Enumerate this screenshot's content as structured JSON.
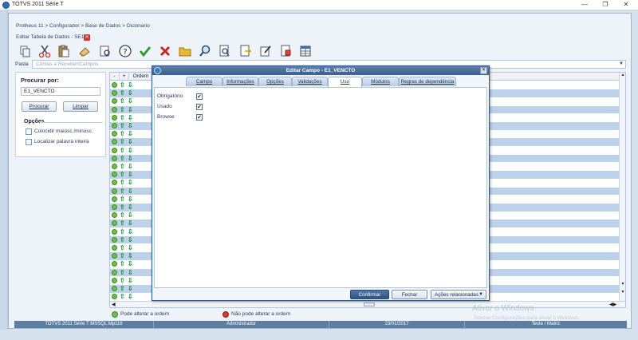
{
  "window": {
    "title": "TOTVS 2011 Série T",
    "minimize": "—",
    "restore": "❐",
    "close": "✕"
  },
  "breadcrumb": "Protheus 11 > Configurador > Base de Dados > Dicionario",
  "doc_tab": {
    "label": "Editar Tabela de Dados - SE1",
    "close": "✕"
  },
  "toolbar": {
    "icons": [
      "copy-icon",
      "cut-icon",
      "paste-icon",
      "eraser-icon",
      "print-preview-icon",
      "help-icon",
      "confirm-check-icon",
      "cancel-x-icon",
      "folder-icon",
      "search-icon",
      "zoom-doc-icon",
      "export-icon",
      "edit-icon",
      "import-icon",
      "table-icon"
    ],
    "colors": {
      "check": "#2e9a2e",
      "cancel": "#cc2020",
      "folder": "#e6b935"
    }
  },
  "path": {
    "label": "Pasta",
    "value": "Contas a Receber\\Campos"
  },
  "search": {
    "title": "Procurar por:",
    "value": "E1_VENCTO",
    "procurar_label": "Procurar",
    "limpar_label": "Limpar",
    "options_title": "Opções",
    "option_case": "Coincidir maiúsc./minúsc.",
    "option_whole": "Localizar palavra inteira"
  },
  "grid": {
    "headers": [
      "-",
      "+",
      "Ordem"
    ],
    "row_count": 27
  },
  "legend": {
    "can_alter": "Pode alterar a ordem",
    "cannot_alter": "Não pode alterar a ordem",
    "colors": {
      "can": "#6bc046",
      "cannot": "#d83a2a"
    }
  },
  "status": {
    "app": "TOTVS 2011 Série T  MSSQL  Mp116",
    "user": "Administrador",
    "date": "23/01/2017",
    "env": "Teste / Matriz"
  },
  "watermark": {
    "line1": "Ativar o Windows",
    "line2": "Acesse Configurações para ativar o Windows."
  },
  "dialog": {
    "title": "Editar Campo - E1_VENCTO",
    "tabs": [
      "Campo",
      "Informações",
      "Opções",
      "Validações",
      "Uso",
      "Módulos",
      "Regras de dependência"
    ],
    "active_tab": "Uso",
    "fields": [
      {
        "label": "Obrigatório",
        "checked": "✔"
      },
      {
        "label": "Usado",
        "checked": "✔"
      },
      {
        "label": "Browse",
        "checked": "✔"
      }
    ],
    "buttons": {
      "confirm": "Confirmar",
      "close": "Fechar",
      "actions": "Ações relacionadas"
    },
    "close": "✕"
  }
}
